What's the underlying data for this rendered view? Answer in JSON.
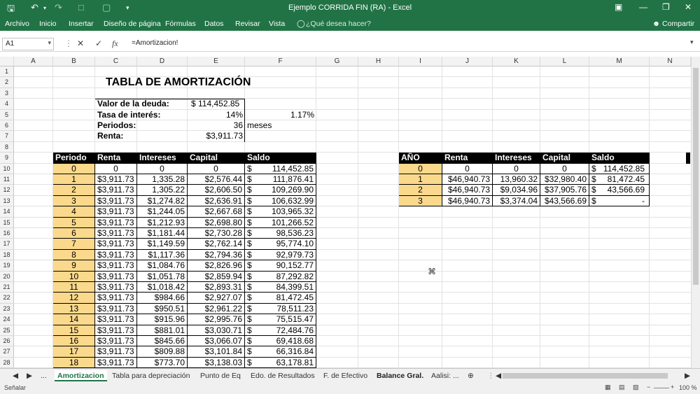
{
  "window": {
    "title": "Ejemplo CORRIDA FIN (RA) - Excel"
  },
  "menu": {
    "items": [
      "Archivo",
      "Inicio",
      "Insertar",
      "Diseño de página",
      "Fórmulas",
      "Datos",
      "Revisar",
      "Vista"
    ],
    "tell": "¿Qué desea hacer?",
    "share": "Compartir"
  },
  "formula_bar": {
    "cell": "A1",
    "formula": "=Amortizacion!"
  },
  "columns": [
    "A",
    "B",
    "C",
    "D",
    "E",
    "F",
    "G",
    "H",
    "I",
    "J",
    "K",
    "L",
    "M",
    "N"
  ],
  "rows": [
    "1",
    "2",
    "3",
    "4",
    "5",
    "6",
    "7",
    "8",
    "9",
    "10",
    "11",
    "12",
    "13",
    "14",
    "15",
    "16",
    "17",
    "18",
    "19",
    "20",
    "21",
    "22",
    "23",
    "24",
    "25",
    "26",
    "27",
    "28"
  ],
  "sheet": {
    "title": "TABLA DE AMORTIZACIÓN",
    "debt_label": "Valor de la deuda:",
    "debt_value": "$ 114,452.85",
    "rate_label": "Tasa de interés:",
    "rate_value": "14%",
    "rate_monthly": "1.17%",
    "periods_label": "Periodos:",
    "periods_value": "36",
    "periods_unit": "meses",
    "rent_label": "Renta:",
    "rent_value": "$3,911.73"
  },
  "main_table": {
    "headers": [
      "Periodo",
      "Renta",
      "Intereses",
      "Capital",
      "Saldo"
    ],
    "rows": [
      [
        "0",
        "0",
        "0",
        "0",
        "114,452.85"
      ],
      [
        "1",
        "$3,911.73",
        "1,335.28",
        "$2,576.44",
        "111,876.41"
      ],
      [
        "2",
        "$3,911.73",
        "1,305.22",
        "$2,606.50",
        "109,269.90"
      ],
      [
        "3",
        "$3,911.73",
        "$1,274.82",
        "$2,636.91",
        "106,632.99"
      ],
      [
        "4",
        "$3,911.73",
        "$1,244.05",
        "$2,667.68",
        "103,965.32"
      ],
      [
        "5",
        "$3,911.73",
        "$1,212.93",
        "$2,698.80",
        "101,266.52"
      ],
      [
        "6",
        "$3,911.73",
        "$1,181.44",
        "$2,730.28",
        "98,536.23"
      ],
      [
        "7",
        "$3,911.73",
        "$1,149.59",
        "$2,762.14",
        "95,774.10"
      ],
      [
        "8",
        "$3,911.73",
        "$1,117.36",
        "$2,794.36",
        "92,979.73"
      ],
      [
        "9",
        "$3,911.73",
        "$1,084.76",
        "$2,826.96",
        "90,152.77"
      ],
      [
        "10",
        "$3,911.73",
        "$1,051.78",
        "$2,859.94",
        "87,292.82"
      ],
      [
        "11",
        "$3,911.73",
        "$1,018.42",
        "$2,893.31",
        "84,399.51"
      ],
      [
        "12",
        "$3,911.73",
        "$984.66",
        "$2,927.07",
        "81,472.45"
      ],
      [
        "13",
        "$3,911.73",
        "$950.51",
        "$2,961.22",
        "78,511.23"
      ],
      [
        "14",
        "$3,911.73",
        "$915.96",
        "$2,995.76",
        "75,515.47"
      ],
      [
        "15",
        "$3,911.73",
        "$881.01",
        "$3,030.71",
        "72,484.76"
      ],
      [
        "16",
        "$3,911.73",
        "$845.66",
        "$3,066.07",
        "69,418.68"
      ],
      [
        "17",
        "$3,911.73",
        "$809.88",
        "$3,101.84",
        "66,316.84"
      ],
      [
        "18",
        "$3,911.73",
        "$773.70",
        "$3,138.03",
        "63,178.81"
      ]
    ]
  },
  "annual_table": {
    "headers": [
      "AÑO",
      "Renta",
      "Intereses",
      "Capital",
      "Saldo"
    ],
    "rows": [
      [
        "0",
        "0",
        "0",
        "0",
        "$",
        "114,452.85"
      ],
      [
        "1",
        "$46,940.73",
        "13,960.32",
        "$32,980.40",
        "$",
        "81,472.45"
      ],
      [
        "2",
        "$46,940.73",
        "$9,034.96",
        "$37,905.76",
        "$",
        "43,566.69"
      ],
      [
        "3",
        "$46,940.73",
        "$3,374.04",
        "$43,566.69",
        "$",
        "-"
      ]
    ]
  },
  "tabs": {
    "items": [
      "...",
      "Amortizacion",
      "Tabla para depreciación",
      "Punto de Eq",
      "Edo. de Resultados",
      "F. de Efectivo",
      "Balance Gral.",
      "Aalisi: ..."
    ]
  },
  "status": {
    "mode": "Señalar",
    "zoom": "100 %"
  },
  "colors": {
    "accent": "#217346",
    "gold": "#fbd98c",
    "header": "#000000"
  }
}
